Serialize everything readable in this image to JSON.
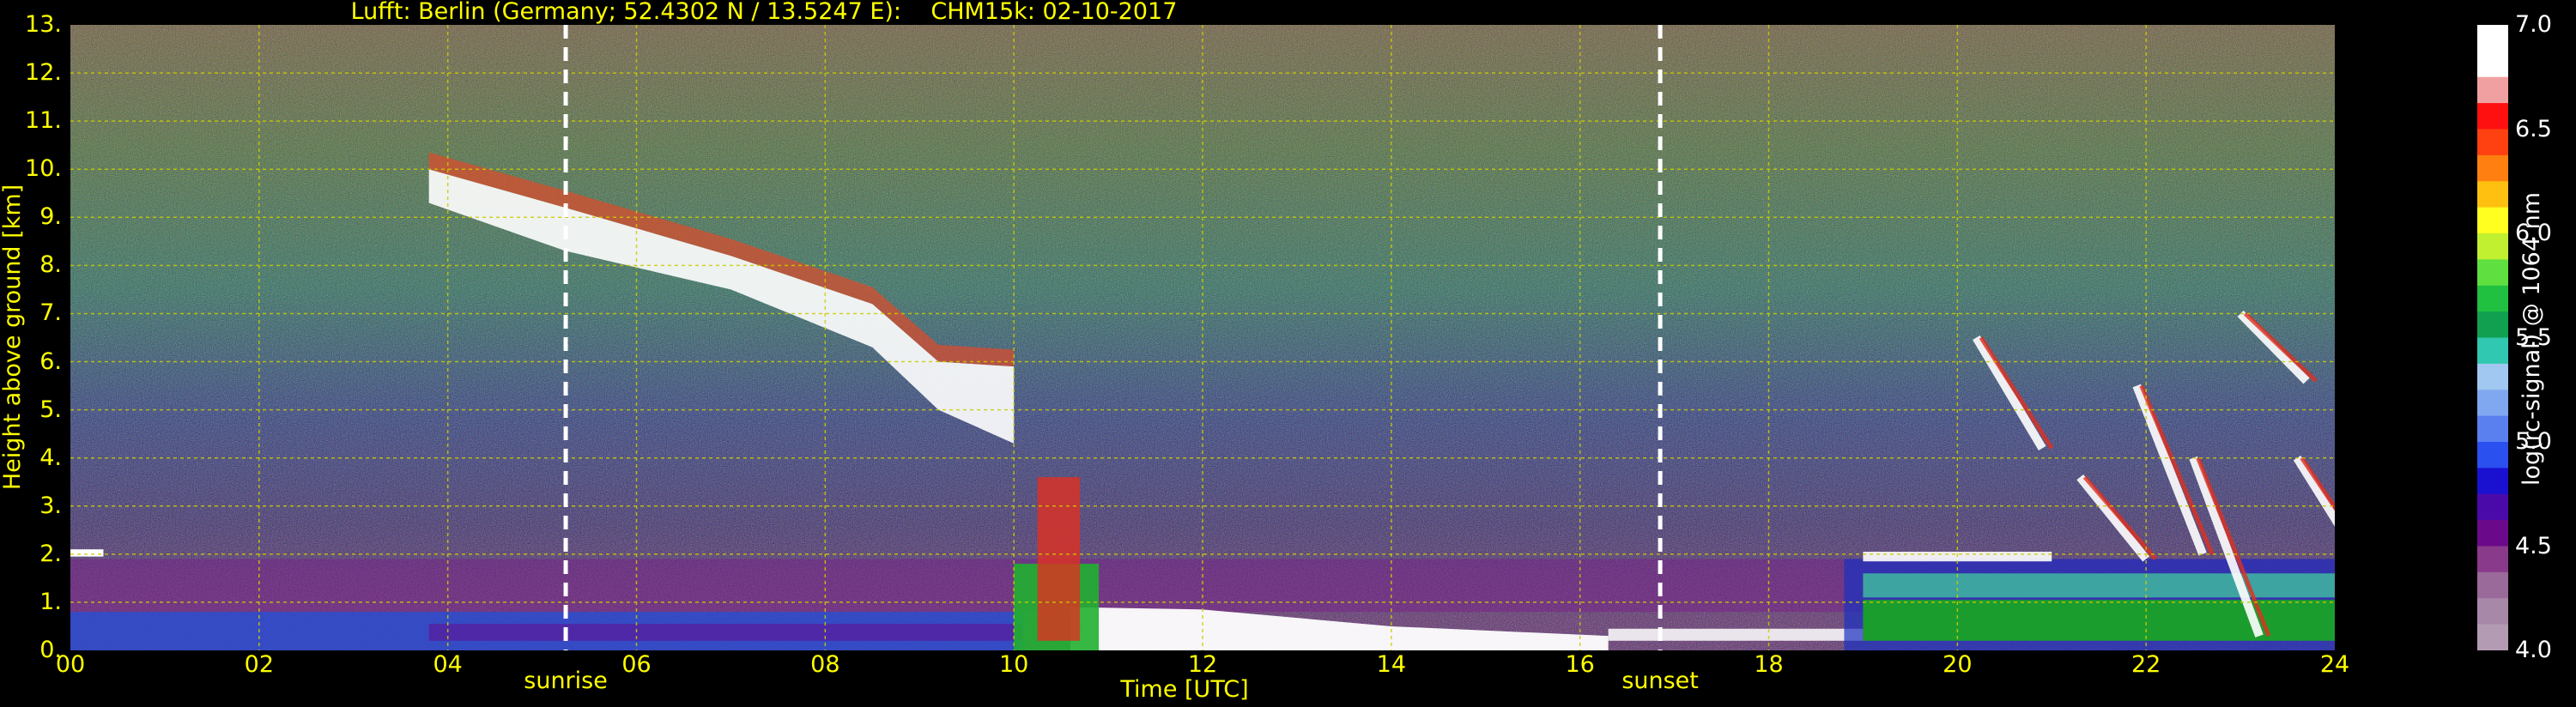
{
  "chart_data": {
    "type": "heatmap",
    "title": "Lufft: Berlin (Germany; 52.4302 N / 13.5247 E):    CHM15k: 02-10-2017",
    "xlabel": "Time [UTC]",
    "ylabel": "Height above ground [km]",
    "xlim": [
      0,
      24
    ],
    "ylim": [
      0,
      13
    ],
    "x_ticks": [
      "00",
      "02",
      "04",
      "06",
      "08",
      "10",
      "12",
      "14",
      "16",
      "18",
      "20",
      "22",
      "24"
    ],
    "y_ticks": [
      "0.",
      "1.",
      "2.",
      "3.",
      "4.",
      "5.",
      "6.",
      "7.",
      "8.",
      "9.",
      "10.",
      "11.",
      "12.",
      "13."
    ],
    "grid": true,
    "events": [
      {
        "label": "sunrise",
        "time_h": 5.25
      },
      {
        "label": "sunset",
        "time_h": 16.85
      }
    ],
    "colorbar": {
      "label": "log(rc-signal) @ 1064 nm",
      "range": [
        4.0,
        7.0
      ],
      "ticks": [
        "4.0",
        "4.5",
        "5.0",
        "5.5",
        "6.0",
        "6.5",
        "7.0"
      ]
    },
    "cirrus_layer_top_km": [
      {
        "t": 3.8,
        "h": 10.0
      },
      {
        "t": 5.25,
        "h": 9.2
      },
      {
        "t": 7.0,
        "h": 8.2
      },
      {
        "t": 8.5,
        "h": 7.2
      },
      {
        "t": 9.2,
        "h": 6.0
      },
      {
        "t": 10.0,
        "h": 5.9
      }
    ],
    "cirrus_layer_base_km": [
      {
        "t": 3.8,
        "h": 9.3
      },
      {
        "t": 5.25,
        "h": 8.3
      },
      {
        "t": 7.0,
        "h": 7.5
      },
      {
        "t": 8.5,
        "h": 6.3
      },
      {
        "t": 9.2,
        "h": 5.0
      },
      {
        "t": 10.0,
        "h": 4.3
      }
    ],
    "boundary_layer_top_km": [
      {
        "t": 0.0,
        "h": 0.8
      },
      {
        "t": 10.0,
        "h": 0.8
      },
      {
        "t": 12.0,
        "h": 0.8
      },
      {
        "t": 14.0,
        "h": 0.6
      },
      {
        "t": 16.0,
        "h": 0.6
      },
      {
        "t": 19.0,
        "h": 1.6
      },
      {
        "t": 21.0,
        "h": 1.8
      },
      {
        "t": 24.0,
        "h": 1.9
      }
    ]
  }
}
